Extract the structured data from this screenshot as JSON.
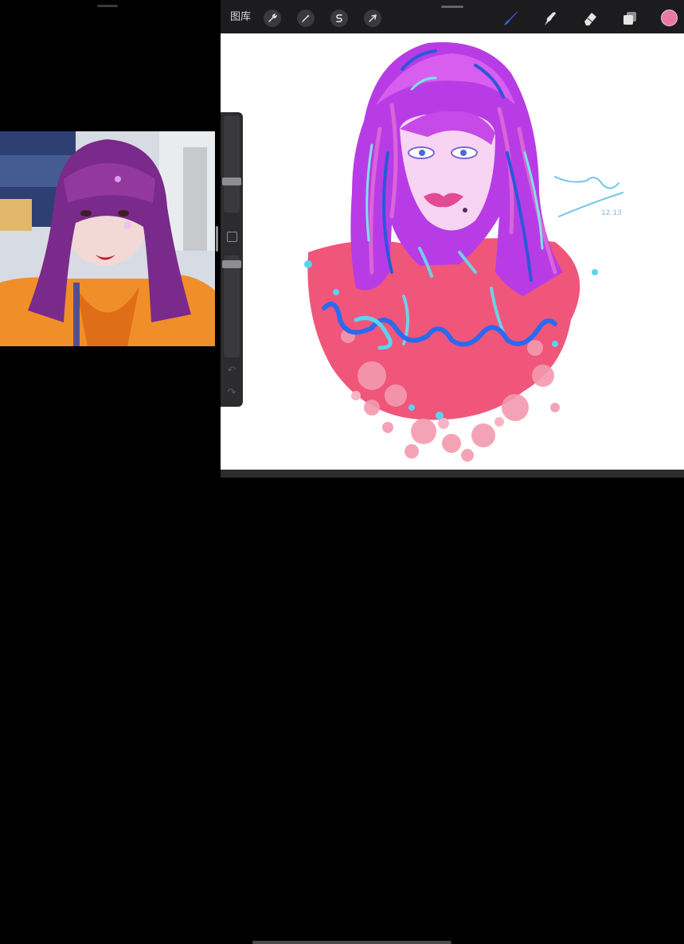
{
  "topbar": {
    "gallery_label": "图库",
    "tools_left": [
      {
        "icon": "wrench-icon",
        "name": "actions"
      },
      {
        "icon": "magic-wand-icon",
        "name": "adjustments"
      },
      {
        "icon": "selection-s-icon",
        "name": "selection"
      },
      {
        "icon": "arrow-cursor-icon",
        "name": "transform"
      }
    ],
    "tools_right": [
      {
        "icon": "brush-icon",
        "name": "paint"
      },
      {
        "icon": "smudge-icon",
        "name": "smudge"
      },
      {
        "icon": "eraser-icon",
        "name": "erase"
      },
      {
        "icon": "layers-icon",
        "name": "layers"
      }
    ],
    "active_color": "#e87aa2",
    "accent_color": "#2f6cf0"
  },
  "sidebar": {
    "undo_icon": "↶",
    "redo_icon": "↷"
  },
  "canvas": {
    "signature_text": "12.13"
  }
}
